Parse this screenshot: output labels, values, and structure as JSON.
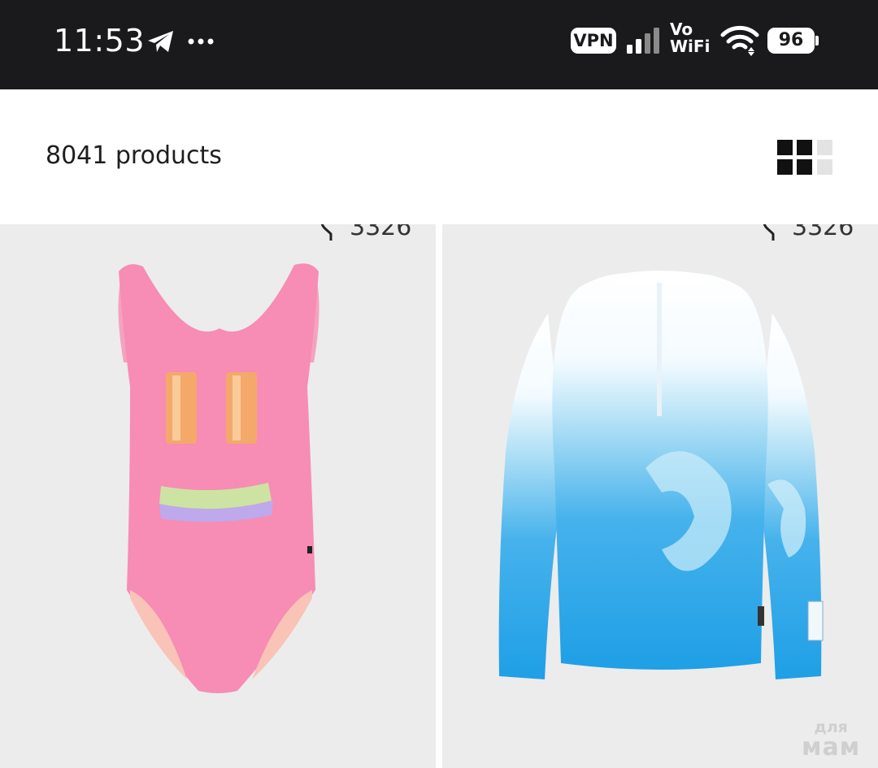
{
  "status_bar": {
    "time": "11:53",
    "vpn_label": "VPN",
    "vowifi_top": "Vo",
    "vowifi_bottom": "WiFi",
    "battery": "96"
  },
  "header": {
    "product_count": "8041 products",
    "view_toggle_icon": "grid-view-icon"
  },
  "products": [
    {
      "likes": "3326",
      "description_icon": "pink-swimsuit-smiley-image"
    },
    {
      "likes": "3326",
      "description_icon": "wave-print-rash-guard-image"
    }
  ],
  "watermark": {
    "small": "для",
    "big": "мам"
  },
  "colors": {
    "status_bar_bg": "#1a1a1c",
    "card_bg": "#ececec",
    "swimsuit_pink": "#f78cb4",
    "wave_blue": "#1f9fe6"
  }
}
